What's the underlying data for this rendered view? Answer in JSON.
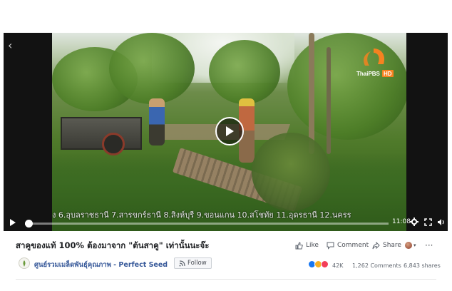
{
  "video": {
    "ticker_text": "ง 6.อุบลราชธานี 7.สารขกร์ธานี 8.สิงห์บุรี 9.ขอนแกน 10.สโชทัย 11.อุดรธานี 12.นครร",
    "elapsed_fraction": 0.01,
    "time_remaining": "11:08",
    "channel_logo_text": "ThaiPBS",
    "channel_logo_badge": "HD"
  },
  "post": {
    "title": "สาคูของแท้ 100% ต้องมาจาก \"ต้นสาคู\" เท่านั้นนะจ๊ะ",
    "actions": {
      "like": "Like",
      "comment": "Comment",
      "share": "Share"
    },
    "page_name": "ศูนย์รวมเมล็ดพันธุ์คุณภาพ - Perfect Seed",
    "follow_label": "Follow",
    "reactions_count": "42K",
    "comments_count": "1,262 Comments",
    "shares_count": "6,843 shares"
  },
  "colors": {
    "link": "#365899",
    "like_blue": "#1877f2",
    "love_red": "#f33e58",
    "wow_yellow": "#f7b125"
  }
}
